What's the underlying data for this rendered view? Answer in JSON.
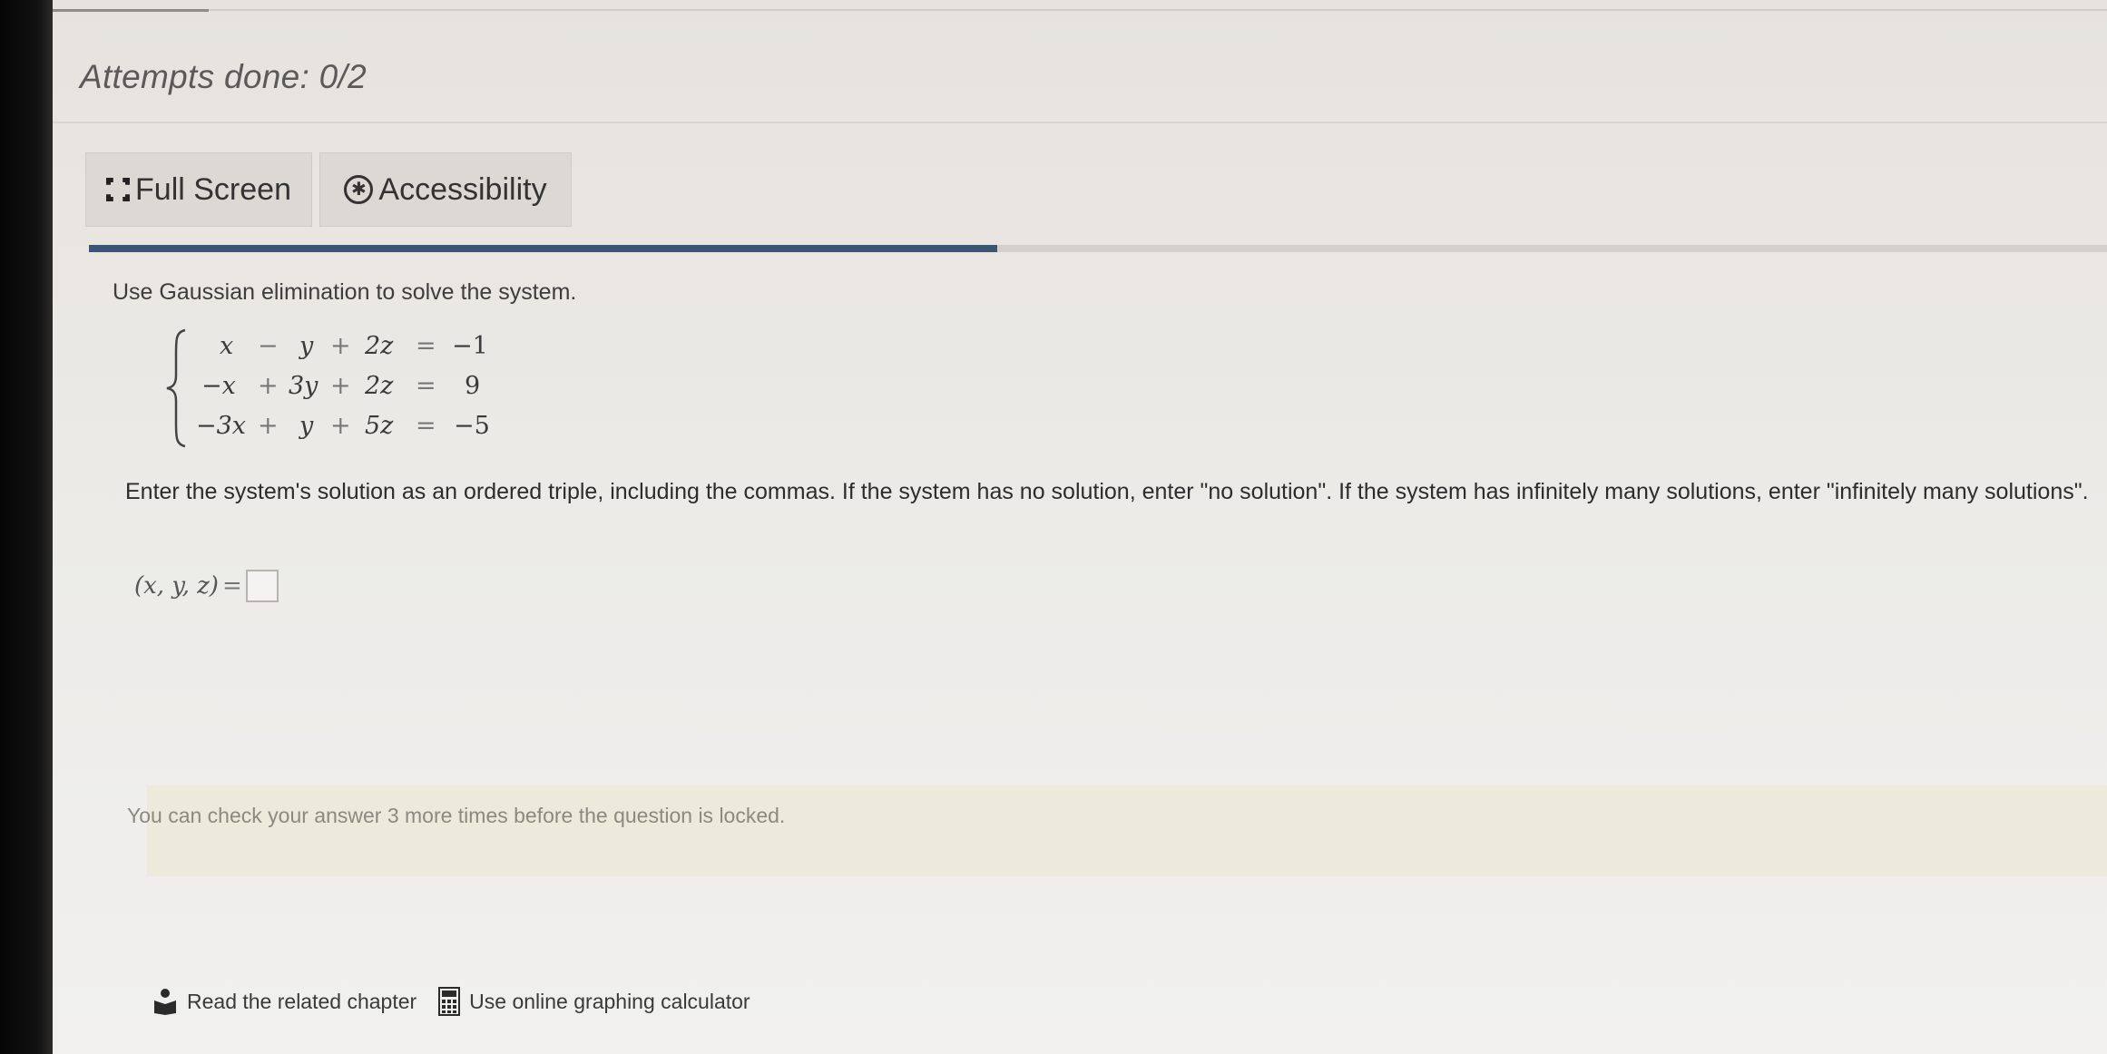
{
  "header": {
    "attempts_label": "Attempts done: 0/2"
  },
  "toolbar": {
    "fullscreen_label": "Full Screen",
    "accessibility_label": "Accessibility"
  },
  "progress": {
    "fraction": 0.45,
    "color": "#3a5674"
  },
  "question": {
    "prompt": "Use Gaussian elimination to solve the system.",
    "system": [
      {
        "a": "x",
        "op1": "−",
        "b": "y",
        "op2": "+",
        "c": "2z",
        "eq": "=",
        "rhs": "−1"
      },
      {
        "a": "−x",
        "op1": "+",
        "b": "3y",
        "op2": "+",
        "c": "2z",
        "eq": "=",
        "rhs": "9"
      },
      {
        "a": "−3x",
        "op1": "+",
        "b": "y",
        "op2": "+",
        "c": "5z",
        "eq": "=",
        "rhs": "−5"
      }
    ],
    "instructions": "Enter the system's solution as an ordered triple, including the commas. If the system has no solution, enter \"no solution\". If the system has infinitely many solutions, enter \"infinitely many solutions\".",
    "answer_label": "(x, y, z)",
    "answer_equals": "=",
    "answer_value": ""
  },
  "notice": {
    "text": "You can check your answer 3 more times before the question is locked."
  },
  "footer": {
    "read_chapter_label": "Read the related chapter",
    "calculator_label": "Use online graphing calculator"
  },
  "icons": {
    "fullscreen": "fullscreen-icon",
    "accessibility": "accessibility-icon",
    "book": "book-icon",
    "calculator": "calculator-icon"
  }
}
